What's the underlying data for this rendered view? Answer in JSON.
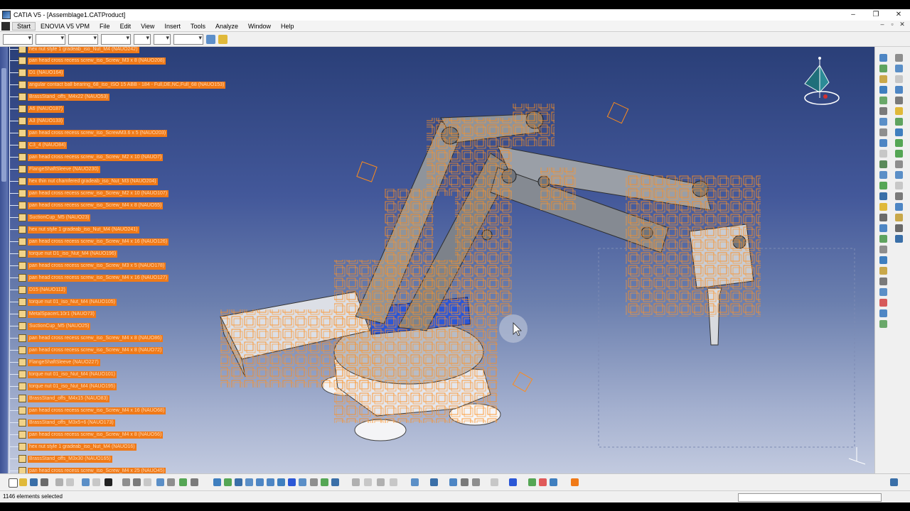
{
  "window": {
    "title": "CATIA V5 - [Assemblage1.CATProduct]",
    "minimize": "–",
    "restore": "❐",
    "close": "✕"
  },
  "menu": {
    "items": [
      "Start",
      "ENOVIA V5 VPM",
      "File",
      "Edit",
      "View",
      "Insert",
      "Tools",
      "Analyze",
      "Window",
      "Help"
    ],
    "doc_controls": [
      "–",
      "▫",
      "✕"
    ]
  },
  "tree": {
    "items": [
      "hex nut style 1 gradeab_iso_Nut_M4 (NAUO242)",
      "pan head cross recess screw_iso_Screw_M3 x 8 (NAUO208)",
      "D1 (NAUO164)",
      "angular contact ball bearing_68_iso_ISO 15 ABB - 184 - Full,DE,NC,Full_68 (NAUO153)",
      "BrassStand_offs_M4x22 (NAUO53)",
      "A6 (NAUO187)",
      "A3 (NAUO133)",
      "pan head cross recess screw_iso_ScrewM3.6 x 5 (NAUO203)",
      "C3_4 (NAUO84)",
      "pan head cross recess screw_iso_Screw_M2 x 10 (NAUO7)",
      "FlangeShaftSleeve (NAUO230)",
      "hex thin nut chamfered gradeab_iso_Nut_M3 (NAUO204)",
      "pan head cross recess screw_iso_Screw_M2 x 10 (NAUO107)",
      "pan head cross recess screw_iso_Screw_M4 x 8 (NAUO55)",
      "SuctionCup_M5 (NAUO23)",
      "hex nut style 1 gradeab_iso_Nut_M4 (NAUO241)",
      "pan head cross recess screw_iso_Screw_M4 x 16 (NAUO126)",
      "torque nut D1_iso_Nut_M4 (NAUO196)",
      "pan head cross recess screw_iso_Screw_M3 x 5 (NAUO178)",
      "pan head cross recess screw_iso_Screw_M4 x 16 (NAUO127)",
      "D15 (NAUO112)",
      "torque nut 01_iso_Nut_M4 (NAUO105)",
      "MetalSpacerL10r1 (NAUO73)",
      "SuctionCup_M5 (NAUO25)",
      "pan head cross recess screw_iso_Screw_M4 x 8 (NAUO86)",
      "pan head cross recess screw_iso_Screw_M4 x 8 (NAUO72)",
      "FlangeShaftSleeve (NAUO227)",
      "torque nut 01_iso_Nut_M4 (NAUO101)",
      "torque nut 01_iso_Nut_M4 (NAUO195)",
      "BrassStand_offs_M4x15 (NAUO83)",
      "pan head cross recess screw_iso_Screw_M4 x 16 (NAUO68)",
      "BrassStand_offs_M3x5+6 (NAUO173)",
      "pan head cross recess screw_iso_Screw_M4 x 8 (NAUO56)",
      "hex nut style 1 gradeab_iso_Nut_M4 (NAUO16)",
      "BrassStand_offs_M3x30 (NAUO165)",
      "pan head cross recess screw_iso_Screw_M4 x 25 (NAUO45)"
    ]
  },
  "colors": {
    "highlight": "#f07a18",
    "viewport_top": "#2a3f78",
    "viewport_bottom": "#c2cadf",
    "arm_metal": "#8f949b"
  },
  "status": {
    "message": "1146 elements selected"
  },
  "icons": {
    "compass": "compass-icon",
    "cursor": "mouse-cursor-icon"
  }
}
